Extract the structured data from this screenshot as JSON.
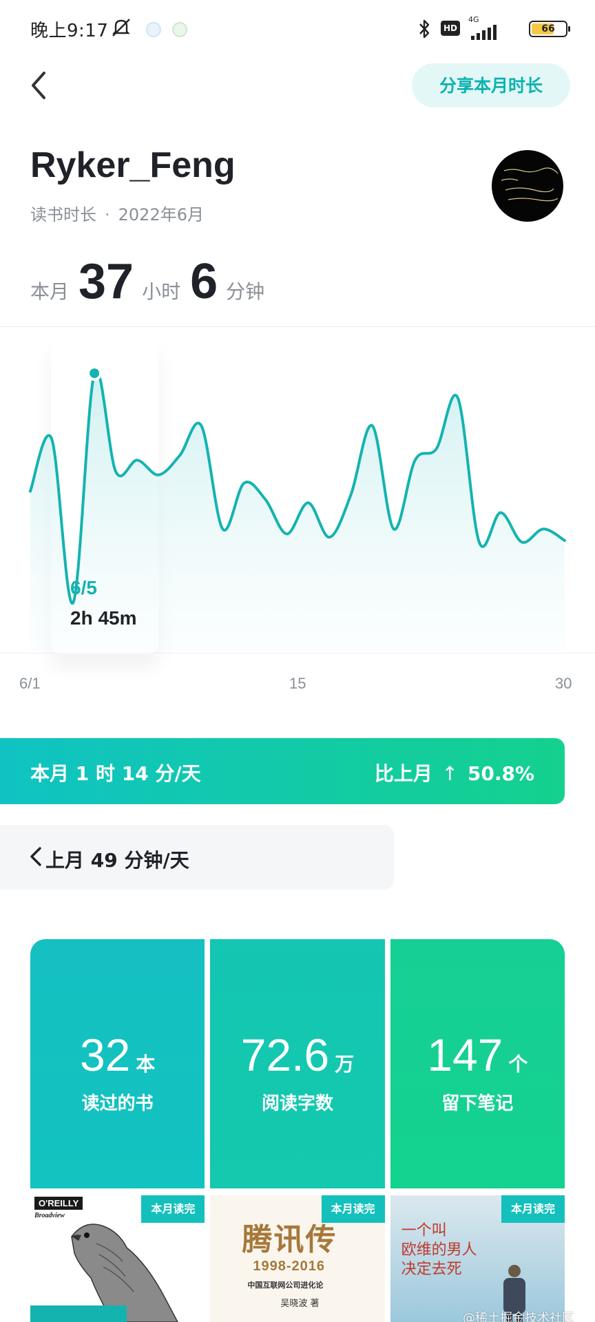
{
  "status_bar": {
    "time": "晚上9:17",
    "hd": "HD",
    "network": "4G",
    "battery_level": "66"
  },
  "header": {
    "share_label": "分享本月时长"
  },
  "profile": {
    "name": "Ryker_Feng",
    "section": "读书时长",
    "month": "2022年6月"
  },
  "total": {
    "prefix": "本月",
    "hours": "37",
    "hours_unit": "小时",
    "minutes": "6",
    "minutes_unit": "分钟"
  },
  "chart_data": {
    "type": "area",
    "x_ticks": [
      "6/1",
      "15",
      "30"
    ],
    "x": [
      1,
      2,
      3,
      4,
      5,
      6,
      7,
      8,
      9,
      10,
      11,
      12,
      13,
      14,
      15,
      16,
      17,
      18,
      19,
      20,
      21,
      22,
      23,
      24,
      25,
      26,
      27,
      28,
      29,
      30
    ],
    "values": [
      93,
      125,
      25,
      165,
      105,
      112,
      103,
      115,
      133,
      70,
      98,
      88,
      67,
      86,
      65,
      91,
      133,
      70,
      112,
      119,
      150,
      62,
      80,
      62,
      70,
      63
    ],
    "y_unit": "minutes",
    "selected": {
      "date": "6/5",
      "value": "2h 45m"
    },
    "accent_color": "#14b3b0"
  },
  "average": {
    "current": "本月 1 时 14 分/天",
    "compare_label": "比上月",
    "compare_arrow": "↑",
    "compare_value": "50.8%",
    "previous": "上月 49 分钟/天"
  },
  "stats": [
    {
      "value": "32",
      "unit": "本",
      "label": "读过的书"
    },
    {
      "value": "72.6",
      "unit": "万",
      "label": "阅读字数"
    },
    {
      "value": "147",
      "unit": "个",
      "label": "留下笔记"
    }
  ],
  "books": [
    {
      "badge": "本月读完",
      "publisher": "O'REILLY",
      "imprint": "Broadview"
    },
    {
      "badge": "本月读完",
      "title": "腾讯传",
      "years": "1998-2016",
      "subtitle": "中国互联网公司进化论",
      "author": "吴晓波 著"
    },
    {
      "badge": "本月读完",
      "title_lines": [
        "一个叫",
        "欧维的男人",
        "决定去死"
      ]
    }
  ],
  "watermark": "@稀土掘金技术社区"
}
